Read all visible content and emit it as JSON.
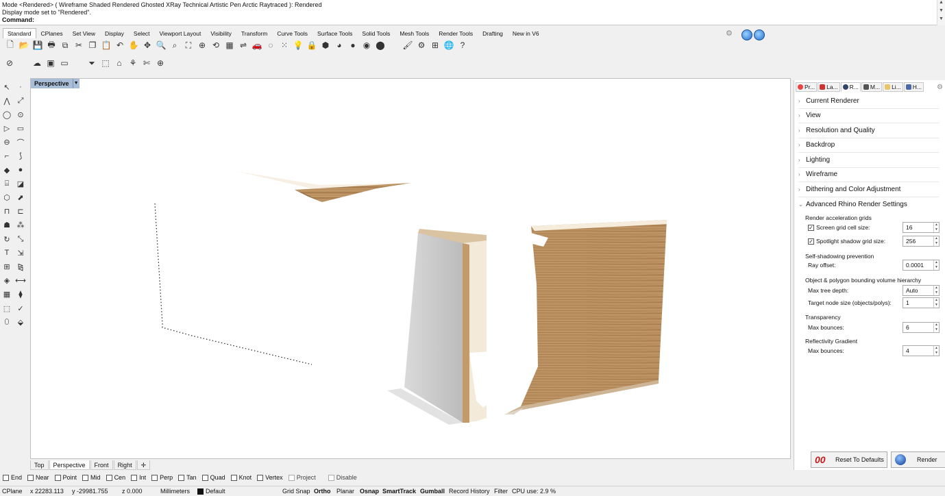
{
  "command_history": [
    "Mode <Rendered> ( Wireframe  Shaded  Rendered  Ghosted  XRay  Technical  Artistic  Pen  Arctic  Raytraced ): Rendered",
    "Display mode set to \"Rendered\"."
  ],
  "command_prompt": "Command:",
  "toolbar_tabs": [
    "Standard",
    "CPlanes",
    "Set View",
    "Display",
    "Select",
    "Viewport Layout",
    "Visibility",
    "Transform",
    "Curve Tools",
    "Surface Tools",
    "Solid Tools",
    "Mesh Tools",
    "Render Tools",
    "Drafting",
    "New in V6"
  ],
  "active_toolbar_tab": "Standard",
  "viewport": {
    "title": "Perspective",
    "tabs": [
      "Top",
      "Perspective",
      "Front",
      "Right"
    ],
    "active_tab": "Perspective"
  },
  "panel": {
    "tabs": [
      "Pr...",
      "La...",
      "R...",
      "M...",
      "Li...",
      "H..."
    ],
    "active_tab": "R...",
    "sections": [
      {
        "label": "Current Renderer",
        "expanded": false
      },
      {
        "label": "View",
        "expanded": false
      },
      {
        "label": "Resolution and Quality",
        "expanded": false
      },
      {
        "label": "Backdrop",
        "expanded": false
      },
      {
        "label": "Lighting",
        "expanded": false
      },
      {
        "label": "Wireframe",
        "expanded": false
      },
      {
        "label": "Dithering and Color Adjustment",
        "expanded": false
      },
      {
        "label": "Advanced Rhino Render Settings",
        "expanded": true
      }
    ],
    "advanced": {
      "render_accel_grids": "Render acceleration grids",
      "screen_grid_label": "Screen grid cell size:",
      "screen_grid_value": "16",
      "spotlight_label": "Spotlight shadow grid size:",
      "spotlight_value": "256",
      "self_shadowing": "Self-shadowing prevention",
      "ray_offset_label": "Ray offset:",
      "ray_offset_value": "0.0001",
      "bvh": "Object & polygon bounding volume hierarchy",
      "max_tree_label": "Max tree depth:",
      "max_tree_value": "Auto",
      "target_node_label": "Target node size (objects/polys):",
      "target_node_value": "1",
      "transparency": "Transparency",
      "trans_bounces_label": "Max bounces:",
      "trans_bounces_value": "6",
      "reflectivity": "Reflectivity Gradient",
      "refl_bounces_label": "Max bounces:",
      "refl_bounces_value": "4"
    },
    "reset_button": "Reset To Defaults",
    "render_button": "Render"
  },
  "osnaps": [
    {
      "label": "End",
      "checked": false
    },
    {
      "label": "Near",
      "checked": false
    },
    {
      "label": "Point",
      "checked": false
    },
    {
      "label": "Mid",
      "checked": false
    },
    {
      "label": "Cen",
      "checked": false
    },
    {
      "label": "Int",
      "checked": false
    },
    {
      "label": "Perp",
      "checked": false
    },
    {
      "label": "Tan",
      "checked": false
    },
    {
      "label": "Quad",
      "checked": false
    },
    {
      "label": "Knot",
      "checked": false
    },
    {
      "label": "Vertex",
      "checked": false
    },
    {
      "label": "Project",
      "checked": false
    },
    {
      "label": "Disable",
      "checked": false
    }
  ],
  "status": {
    "cplane": "CPlane",
    "x": "x 22283.113",
    "y": "y -29981.755",
    "z": "z 0.000",
    "units": "Millimeters",
    "layer": "Default",
    "grid_snap": "Grid Snap",
    "ortho": "Ortho",
    "planar": "Planar",
    "osnap": "Osnap",
    "smarttrack": "SmartTrack",
    "gumball": "Gumball",
    "record_history": "Record History",
    "filter": "Filter",
    "cpu": "CPU use: 2.9 %"
  },
  "colors": {
    "viewport_title_bg": "#a8bdd8",
    "wood": "#b8905c"
  }
}
